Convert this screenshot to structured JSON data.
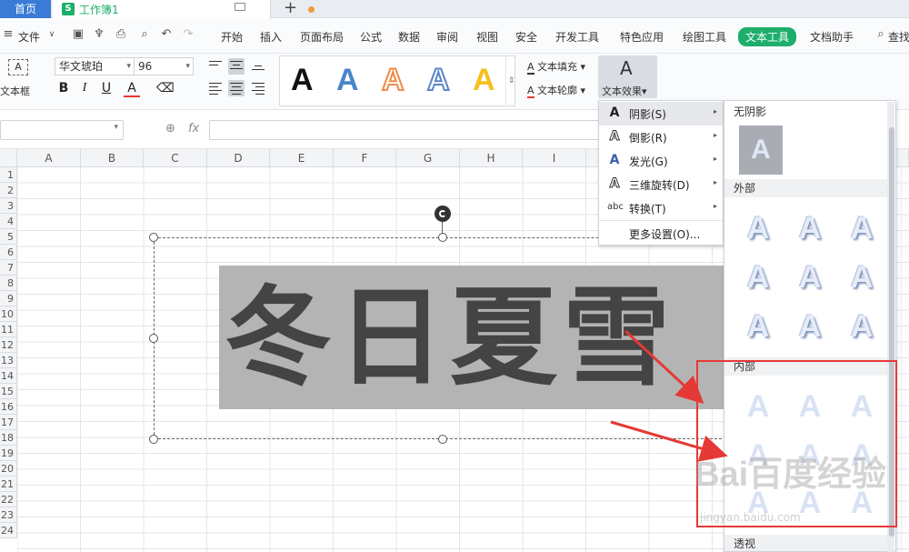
{
  "tabs": {
    "home": "首页",
    "doc_title": "工作簿1",
    "doc_icon": "S"
  },
  "menubar": {
    "file": "文件",
    "items": [
      "开始",
      "插入",
      "页面布局",
      "公式",
      "数据",
      "审阅",
      "视图",
      "安全",
      "开发工具",
      "特色应用",
      "绘图工具",
      "文本工具",
      "文档助手",
      "查找"
    ],
    "active": "文本工具"
  },
  "ribbon": {
    "textbox_label": "文本框",
    "textbox_icon_text": "A",
    "font": "华文琥珀",
    "size": "96",
    "bold": "B",
    "italic": "I",
    "underline": "U",
    "font_color": "A",
    "style_glyph": "A",
    "fill": "文本填充",
    "outline": "文本轮廓",
    "effects": "文本效果",
    "effects_icon": "A"
  },
  "formula": {
    "fx": "fx"
  },
  "grid": {
    "columns": [
      "A",
      "B",
      "C",
      "D",
      "E",
      "F",
      "G",
      "H",
      "I"
    ],
    "rows": [
      "1",
      "2",
      "3",
      "4",
      "5",
      "6",
      "7",
      "8",
      "9",
      "10",
      "11",
      "12",
      "13",
      "14",
      "15",
      "16",
      "17",
      "18",
      "19",
      "20",
      "21",
      "22",
      "23",
      "24"
    ]
  },
  "textbox": {
    "content": "冬日夏雪",
    "fill_color": "#444444",
    "highlight": "#b4b4b4"
  },
  "effects_menu": {
    "items": [
      {
        "label": "阴影(S)",
        "icon": "A",
        "submenu": true
      },
      {
        "label": "倒影(R)",
        "icon": "A",
        "submenu": true
      },
      {
        "label": "发光(G)",
        "icon": "A",
        "submenu": true
      },
      {
        "label": "三维旋转(D)",
        "icon": "A",
        "submenu": true
      },
      {
        "label": "转换(T)",
        "icon": "abc",
        "submenu": true
      }
    ],
    "more": "更多设置(O)..."
  },
  "shadow_gallery": {
    "none_header": "无阴影",
    "outer_header": "外部",
    "inner_header": "内部",
    "perspective_header": "透视",
    "glyph": "A"
  },
  "watermark": {
    "logo": "Bai百度经验",
    "url": "jingyan.baidu.com"
  },
  "colors": {
    "accent_green": "#1eae6b",
    "home_tab": "#3a7bd5",
    "annotation_red": "#e53935"
  }
}
